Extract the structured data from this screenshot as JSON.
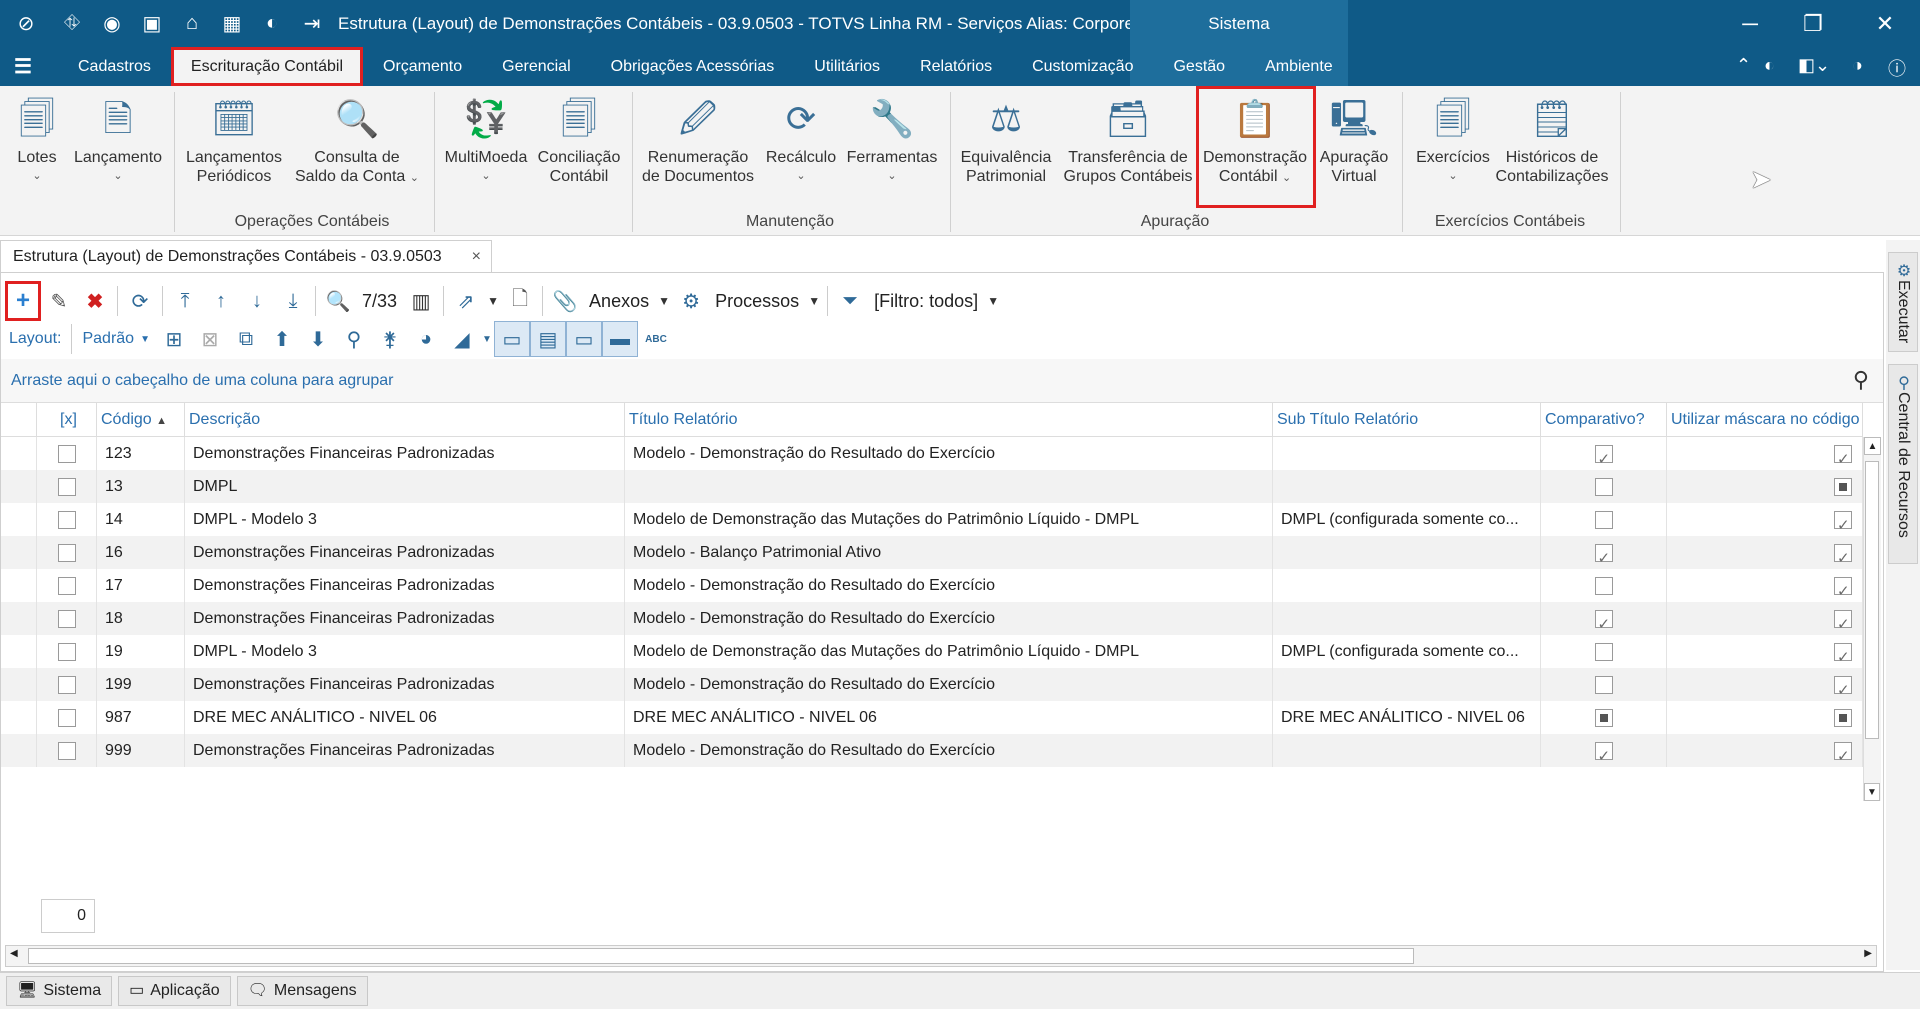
{
  "window": {
    "title": "Estrutura (Layout) de Demonstrações Contábeis - 03.9.0503 - TOTVS Linha RM - Serviços  Alias: Corpore...",
    "sistema_tab": "Sistema"
  },
  "menu": {
    "items": [
      "Cadastros",
      "Escrituração Contábil",
      "Orçamento",
      "Gerencial",
      "Obrigações Acessórias",
      "Utilitários",
      "Relatórios",
      "Customização",
      "Gestão",
      "Ambiente"
    ],
    "active_index": 1
  },
  "ribbon": {
    "buttons": [
      {
        "l1": "Lotes",
        "l2": ""
      },
      {
        "l1": "Lançamento",
        "l2": ""
      },
      {
        "l1": "Lançamentos",
        "l2": "Periódicos"
      },
      {
        "l1": "Consulta de",
        "l2": "Saldo da Conta"
      },
      {
        "l1": "MultiMoeda",
        "l2": ""
      },
      {
        "l1": "Conciliação",
        "l2": "Contábil"
      },
      {
        "l1": "Renumeração",
        "l2": "de Documentos"
      },
      {
        "l1": "Recálculo",
        "l2": ""
      },
      {
        "l1": "Ferramentas",
        "l2": ""
      },
      {
        "l1": "Equivalência",
        "l2": "Patrimonial"
      },
      {
        "l1": "Transferência de",
        "l2": "Grupos Contábeis"
      },
      {
        "l1": "Demonstração",
        "l2": "Contábil"
      },
      {
        "l1": "Apuração",
        "l2": "Virtual"
      },
      {
        "l1": "Exercícios",
        "l2": ""
      },
      {
        "l1": "Históricos de",
        "l2": "Contabilizações"
      }
    ],
    "groups": [
      "Operações Contábeis",
      "Manutenção",
      "Apuração",
      "Exercícios Contábeis"
    ]
  },
  "doc_tab": {
    "label": "Estrutura (Layout) de Demonstrações Contábeis - 03.9.0503",
    "close": "×"
  },
  "toolbar": {
    "record_position": "7/33",
    "anexos": "Anexos",
    "processos": "Processos",
    "filtro": "[Filtro: todos]",
    "layout_label": "Layout:",
    "layout_value": "Padrão"
  },
  "group_hint": "Arraste aqui o cabeçalho de uma coluna para agrupar",
  "grid": {
    "columns": [
      "[x]",
      "Código",
      "Descrição",
      "Título  Relatório",
      "Sub Título Relatório",
      "Comparativo?",
      "Utilizar máscara no código do"
    ],
    "rows": [
      {
        "codigo": "123",
        "descricao": "Demonstrações Financeiras Padronizadas",
        "titulo": "Modelo - Demonstração do Resultado do Exercício",
        "subtitulo": "",
        "comparativo": "checked",
        "mascara": "checked"
      },
      {
        "codigo": "13",
        "descricao": "DMPL",
        "titulo": "",
        "subtitulo": "",
        "comparativo": "unchecked",
        "mascara": "indeterminate"
      },
      {
        "codigo": "14",
        "descricao": "DMPL - Modelo 3",
        "titulo": "Modelo de Demonstração das Mutações do Patrimônio Líquido - DMPL",
        "subtitulo": "DMPL (configurada somente co...",
        "comparativo": "unchecked",
        "mascara": "checked"
      },
      {
        "codigo": "16",
        "descricao": "Demonstrações Financeiras Padronizadas",
        "titulo": "Modelo - Balanço Patrimonial Ativo",
        "subtitulo": "",
        "comparativo": "checked",
        "mascara": "checked"
      },
      {
        "codigo": "17",
        "descricao": "Demonstrações Financeiras Padronizadas",
        "titulo": "Modelo - Demonstração do Resultado do Exercício",
        "subtitulo": "",
        "comparativo": "unchecked",
        "mascara": "checked"
      },
      {
        "codigo": "18",
        "descricao": "Demonstrações Financeiras Padronizadas",
        "titulo": "Modelo - Demonstração do Resultado do Exercício",
        "subtitulo": "",
        "comparativo": "checked",
        "mascara": "checked"
      },
      {
        "codigo": "19",
        "descricao": "DMPL - Modelo 3",
        "titulo": "Modelo de Demonstração das Mutações do Patrimônio Líquido - DMPL",
        "subtitulo": "DMPL (configurada somente co...",
        "comparativo": "unchecked",
        "mascara": "checked"
      },
      {
        "codigo": "199",
        "descricao": "Demonstrações Financeiras Padronizadas",
        "titulo": "Modelo - Demonstração do Resultado do Exercício",
        "subtitulo": "",
        "comparativo": "unchecked",
        "mascara": "checked"
      },
      {
        "codigo": "987",
        "descricao": "DRE MEC ANÁLITICO - NIVEL 06",
        "titulo": "DRE MEC ANÁLITICO - NIVEL 06",
        "subtitulo": "DRE MEC ANÁLITICO - NIVEL 06",
        "comparativo": "indeterminate",
        "mascara": "indeterminate"
      },
      {
        "codigo": "999",
        "descricao": "Demonstrações Financeiras Padronizadas",
        "titulo": "Modelo - Demonstração do Resultado do Exercício",
        "subtitulo": "",
        "comparativo": "checked",
        "mascara": "checked"
      }
    ]
  },
  "footer_count": "0",
  "side_tabs": [
    "Executar",
    "Central de Recursos"
  ],
  "status_buttons": [
    "Sistema",
    "Aplicação",
    "Mensagens"
  ],
  "colors": {
    "titlebar": "#0f5a87",
    "highlight": "#e02020",
    "link": "#2a6fae"
  }
}
